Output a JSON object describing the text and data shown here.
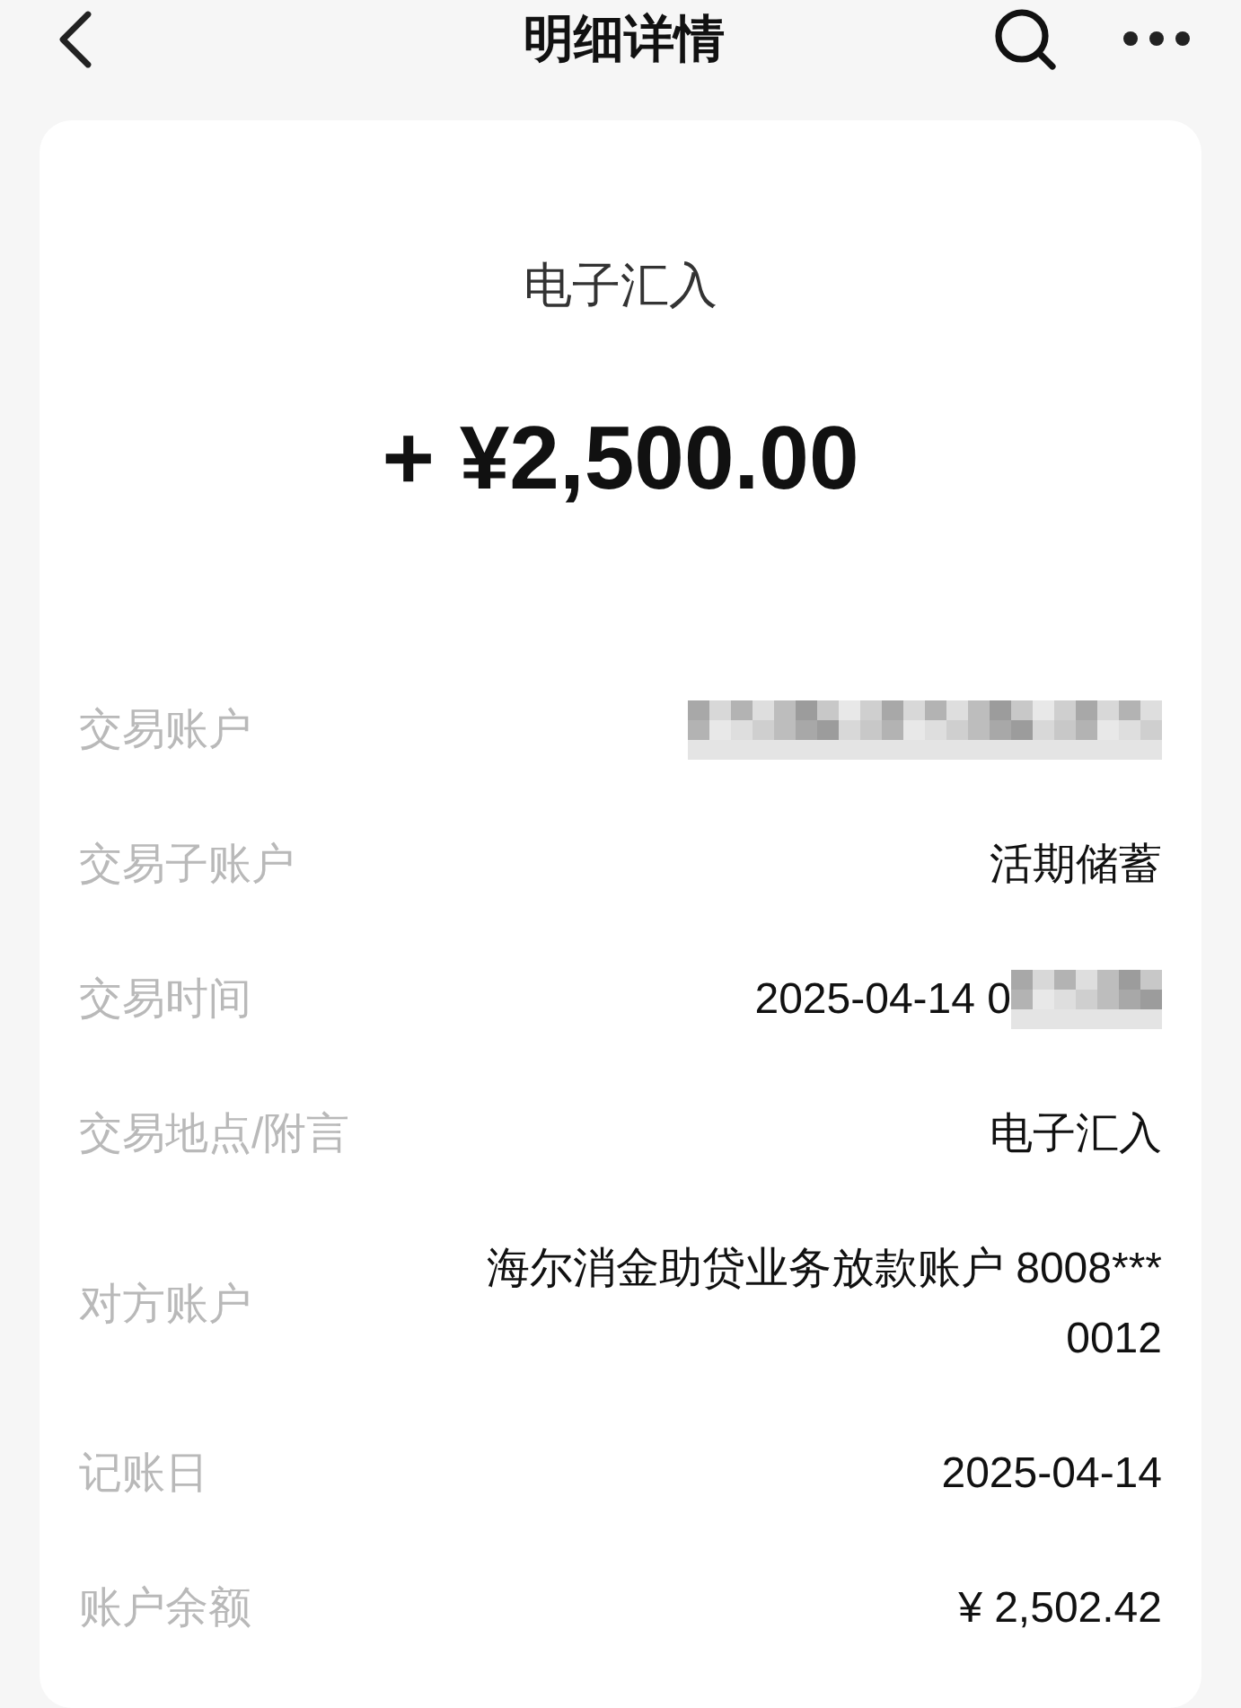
{
  "header": {
    "title": "明细详情"
  },
  "summary": {
    "type": "电子汇入",
    "amount": "+ ¥2,500.00"
  },
  "details": [
    {
      "label": "交易账户",
      "value": [
        {
          "kind": "redacted"
        }
      ]
    },
    {
      "label": "交易子账户",
      "value": [
        {
          "kind": "text",
          "text": "活期储蓄"
        }
      ]
    },
    {
      "label": "交易时间",
      "value": [
        {
          "kind": "text",
          "text": "2025-04-14 0"
        },
        {
          "kind": "redacted"
        }
      ]
    },
    {
      "label": "交易地点/附言",
      "value": [
        {
          "kind": "text",
          "text": "电子汇入"
        }
      ]
    },
    {
      "label": "对方账户",
      "value": [
        {
          "kind": "text",
          "text": "海尔消金助贷业务放款账户 8008***\n0012"
        }
      ]
    },
    {
      "label": "记账日",
      "value": [
        {
          "kind": "text",
          "text": "2025-04-14"
        }
      ]
    },
    {
      "label": "账户余额",
      "value": [
        {
          "kind": "text",
          "text": "¥ 2,502.42"
        }
      ]
    }
  ]
}
